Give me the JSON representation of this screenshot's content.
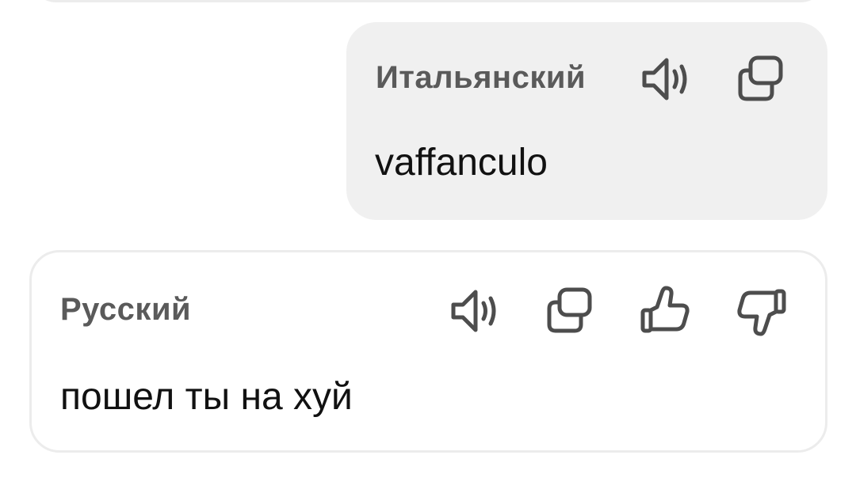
{
  "source": {
    "language": "Итальянский",
    "text": "vaffanculo",
    "icons": [
      "speaker-icon",
      "copy-icon"
    ]
  },
  "target": {
    "language": "Русский",
    "text": "пошел ты на хуй",
    "icons": [
      "speaker-icon",
      "copy-icon",
      "thumbs-up-icon",
      "thumbs-down-icon"
    ]
  },
  "colors": {
    "source_card_bg": "#f0f0f0",
    "card_border": "#ececec",
    "label": "#5a5a5a",
    "text": "#111111",
    "icon": "#4d4d4d"
  }
}
